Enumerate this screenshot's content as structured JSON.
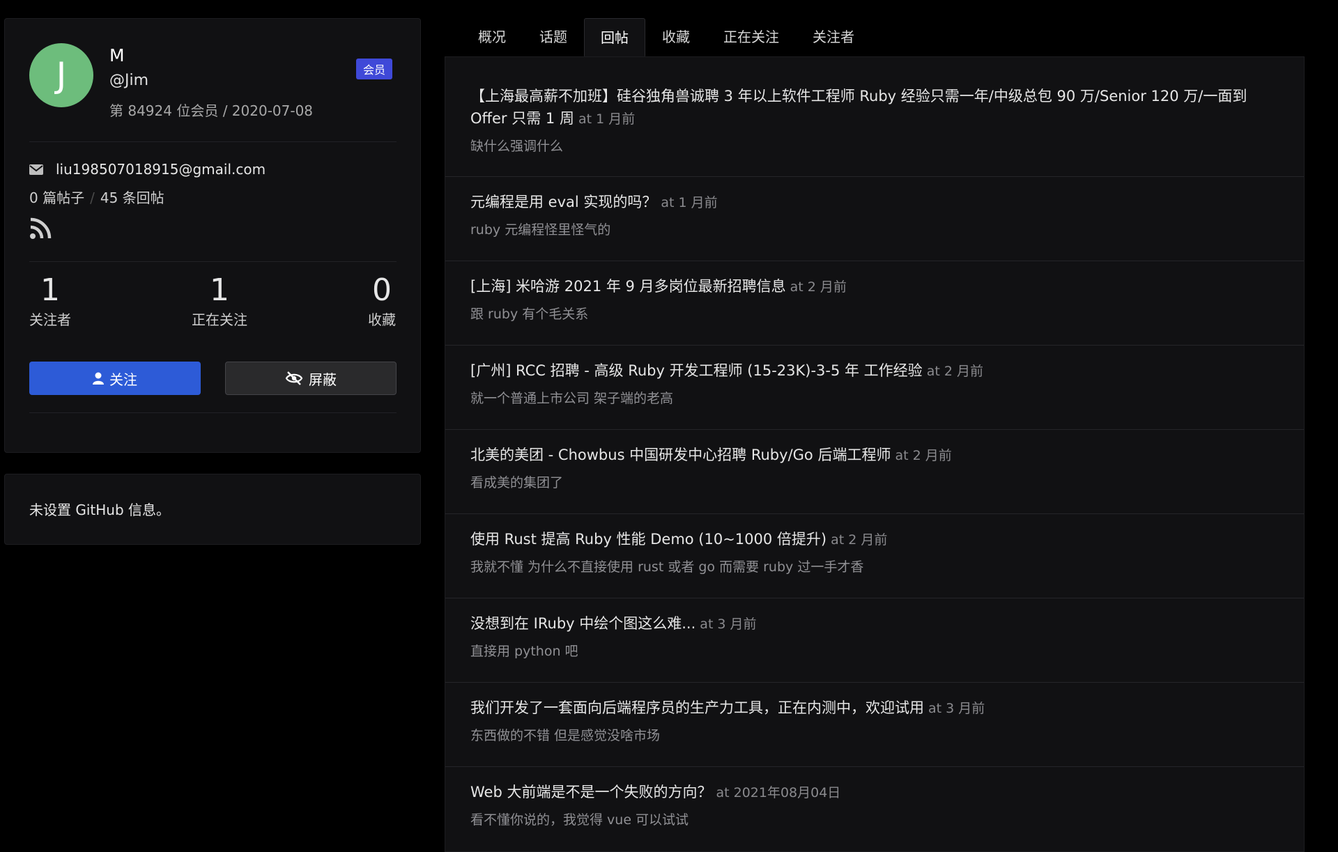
{
  "profile": {
    "avatar_letter": "J",
    "name": "M",
    "login": "@Jim",
    "meta": "第 84924 位会员 / 2020-07-08",
    "badge": "会员",
    "email": "liu198507018915@gmail.com",
    "topics_count": "0 篇帖子",
    "replies_count": "45 条回帖",
    "stats": [
      {
        "num": "1",
        "label": "关注者"
      },
      {
        "num": "1",
        "label": "正在关注"
      },
      {
        "num": "0",
        "label": "收藏"
      }
    ],
    "follow_label": "关注",
    "block_label": "屏蔽"
  },
  "github": {
    "text": "未设置 GitHub 信息。"
  },
  "tabs": [
    {
      "label": "概况"
    },
    {
      "label": "话题"
    },
    {
      "label": "回帖"
    },
    {
      "label": "收藏"
    },
    {
      "label": "正在关注"
    },
    {
      "label": "关注者"
    }
  ],
  "replies": [
    {
      "title": "【上海最高薪不加班】硅谷独角兽诚聘 3 年以上软件工程师 Ruby 经验只需一年/中级总包 90 万/Senior 120 万/一面到 Offer 只需 1 周",
      "at": "at 1 月前",
      "snippet": "缺什么强调什么"
    },
    {
      "title": "元编程是用 eval 实现的吗？",
      "at": "at 1 月前",
      "snippet": "ruby 元编程怪里怪气的"
    },
    {
      "title": "[上海] 米哈游 2021 年 9 月多岗位最新招聘信息",
      "at": "at 2 月前",
      "snippet": "跟 ruby 有个毛关系"
    },
    {
      "title": "[广州] RCC 招聘 - 高级 Ruby 开发工程师 (15-23K)-3-5 年 工作经验",
      "at": "at 2 月前",
      "snippet": "就一个普通上市公司 架子端的老高"
    },
    {
      "title": "北美的美团 - Chowbus 中国研发中心招聘 Ruby/Go 后端工程师",
      "at": "at 2 月前",
      "snippet": "看成美的集团了"
    },
    {
      "title": "使用 Rust 提高 Ruby 性能 Demo (10~1000 倍提升)",
      "at": "at 2 月前",
      "snippet": "我就不懂 为什么不直接使用 rust 或者 go 而需要 ruby 过一手才香"
    },
    {
      "title": "没想到在 IRuby 中绘个图这么难...",
      "at": "at 3 月前",
      "snippet": "直接用 python 吧"
    },
    {
      "title": "我们开发了一套面向后端程序员的生产力工具，正在内测中，欢迎试用",
      "at": "at 3 月前",
      "snippet": "东西做的不错 但是感觉没啥市场"
    },
    {
      "title": "Web 大前端是不是一个失败的方向？",
      "at": "at 2021年08月04日",
      "snippet": "看不懂你说的，我觉得 vue 可以试试"
    }
  ]
}
